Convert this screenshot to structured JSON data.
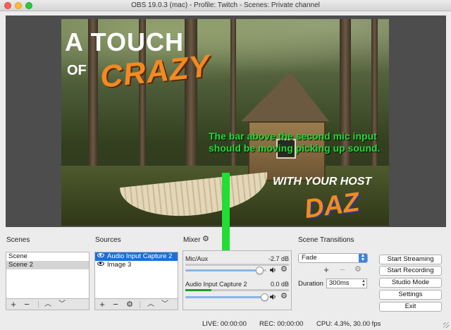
{
  "window": {
    "title": "OBS 19.0.3 (mac) - Profile: Twitch - Scenes: Private channel"
  },
  "preview": {
    "title_line1": "A TOUCH",
    "title_of": "OF",
    "title_crazy": "CRAZY",
    "host_text": "WITH YOUR HOST",
    "host_name": "DAZ"
  },
  "annotation": {
    "text": "The bar above the second mic input should be moving picking up sound.",
    "color": "#22dd33"
  },
  "scenes": {
    "label": "Scenes",
    "items": [
      {
        "label": "Scene"
      },
      {
        "label": "Scene 2",
        "selected": true
      }
    ]
  },
  "sources": {
    "label": "Sources",
    "items": [
      {
        "label": "Audio Input Capture 2",
        "active": true
      },
      {
        "label": "Image 3"
      }
    ]
  },
  "mixer": {
    "label": "Mixer",
    "channels": [
      {
        "name": "Mic/Aux",
        "db": "-2.7 dB",
        "volume": 0.92,
        "level": 0.0
      },
      {
        "name": "Audio Input Capture 2",
        "db": "0.0 dB",
        "volume": 0.98,
        "level": 0.25
      }
    ]
  },
  "transitions": {
    "label": "Scene Transitions",
    "selected": "Fade",
    "duration_label": "Duration",
    "duration_value": "300ms"
  },
  "controls": {
    "start_streaming": "Start Streaming",
    "start_recording": "Start Recording",
    "studio_mode": "Studio Mode",
    "settings": "Settings",
    "exit": "Exit"
  },
  "status": {
    "live": "LIVE: 00:00:00",
    "rec": "REC: 00:00:00",
    "cpu": "CPU: 4.3%, 30.00 fps"
  },
  "colors": {
    "accent": "#1d6fd8",
    "arrow": "#22dd33",
    "brand_orange": "#f28a22"
  },
  "icons": {
    "add": "+",
    "remove": "−",
    "up": "︿",
    "down": "﹀",
    "gear": "⚙"
  }
}
